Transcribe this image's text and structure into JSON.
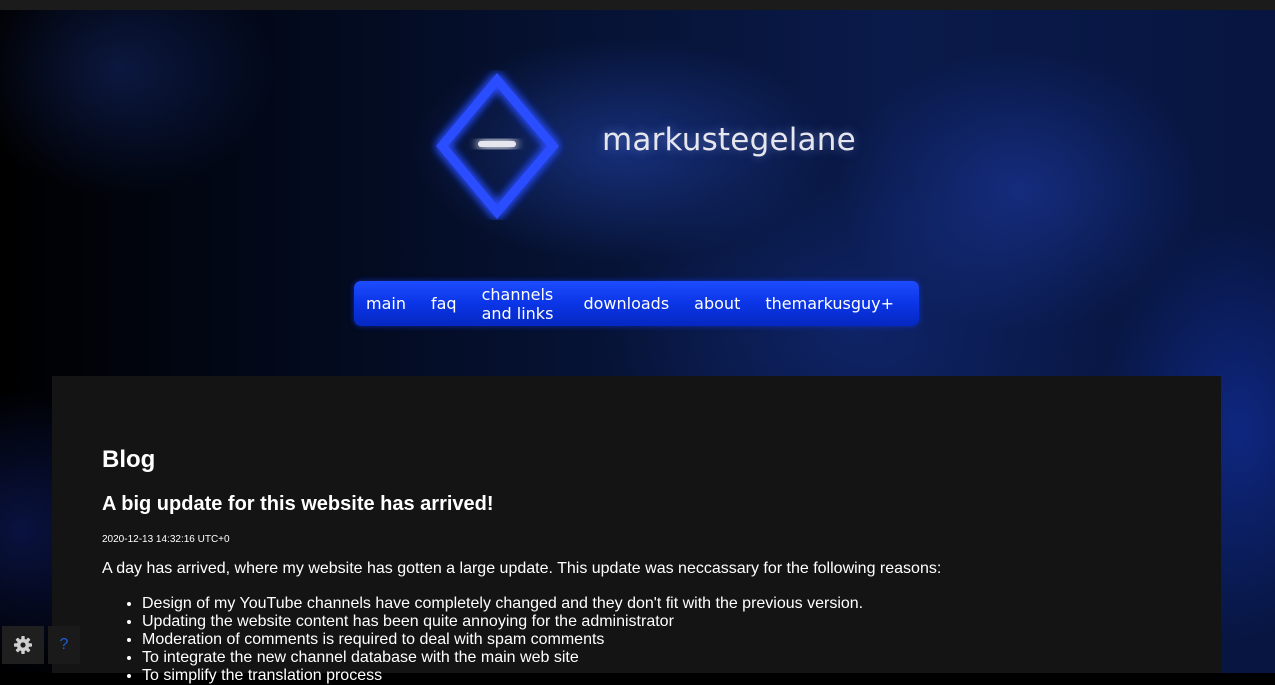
{
  "site": {
    "name": "markustegelane",
    "colors": {
      "nav_bg": "#0b35e6",
      "content_bg": "#141414",
      "accent": "#1a36ff"
    }
  },
  "nav": {
    "items": [
      {
        "label": "main"
      },
      {
        "label": "faq"
      },
      {
        "label": "channels and links"
      },
      {
        "label": "downloads"
      },
      {
        "label": "about"
      },
      {
        "label": "themarkusguy+"
      }
    ]
  },
  "blog": {
    "heading": "Blog",
    "post": {
      "title": "A big update for this website has arrived!",
      "timestamp": "2020-12-13 14:32:16 UTC+0",
      "intro": "A day has arrived, where my website has gotten a large update. This update was neccassary for the following reasons:",
      "reasons": [
        "Design of my YouTube channels have completely changed and they don't fit with the previous version.",
        "Updating the website content has been quite annoying for the administrator",
        "Moderation of comments is required to deal with spam comments",
        "To integrate the new channel database with the main web site",
        "To simplify the translation process"
      ]
    }
  },
  "corner_buttons": {
    "settings_icon": "gear-icon",
    "help_label": "?"
  }
}
